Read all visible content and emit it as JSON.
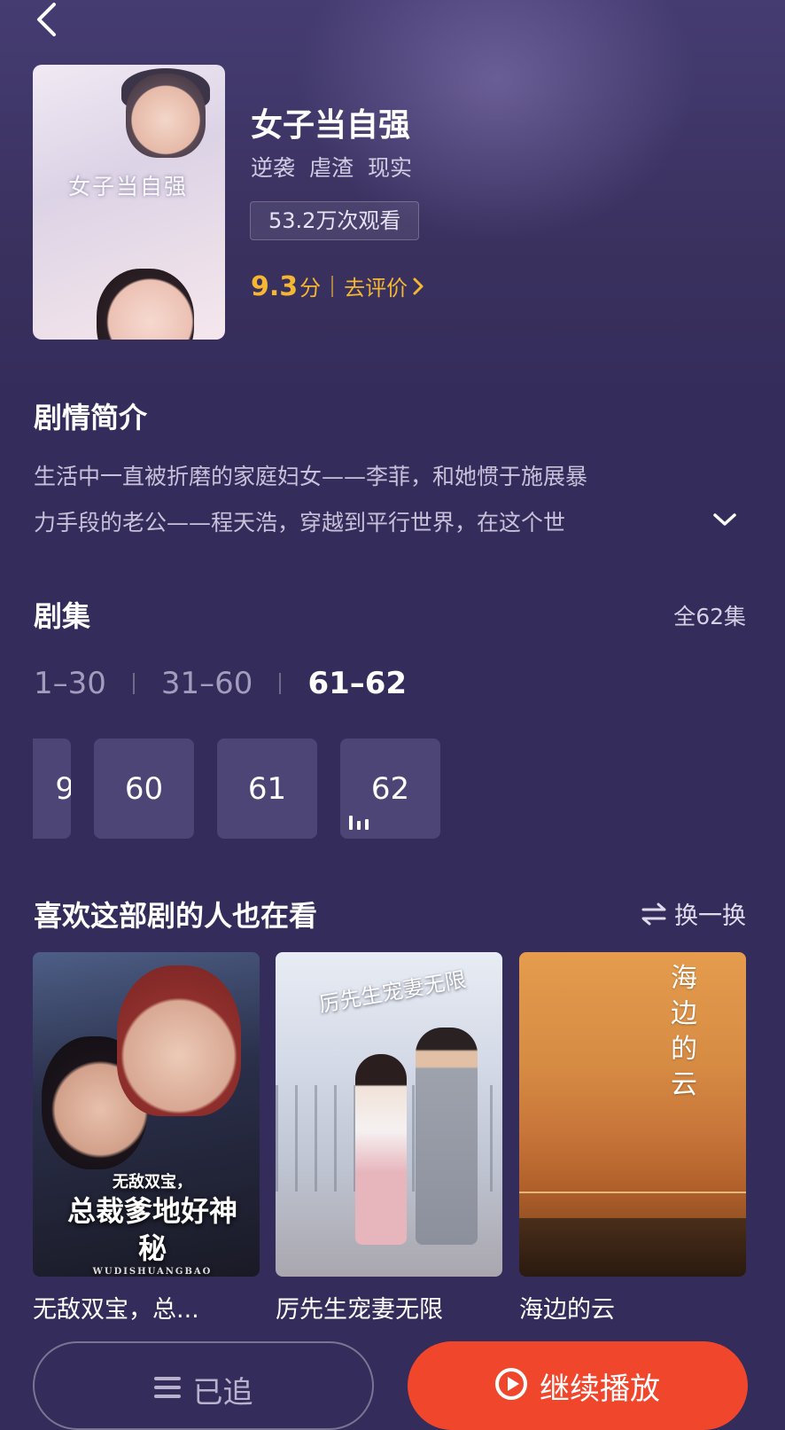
{
  "drama": {
    "title": "女子当自强",
    "poster_text": "女子当自强",
    "tags": [
      "逆袭",
      "虐渣",
      "现实"
    ],
    "views": "53.2万次观看",
    "score": "9.3",
    "score_unit": "分",
    "rate_label": "去评价"
  },
  "synopsis": {
    "heading": "剧情简介",
    "line1": "生活中一直被折磨的家庭妇女——李菲，和她惯于施展暴",
    "line2": "力手段的老公——程天浩，穿越到平行世界，在这个世"
  },
  "episodes": {
    "heading": "剧集",
    "total": "全62集",
    "ranges": [
      "1–30",
      "31–60",
      "61–62"
    ],
    "active_range": "61–62",
    "visible": [
      "9",
      "60",
      "61",
      "62"
    ],
    "playing": "62"
  },
  "recommend": {
    "heading": "喜欢这部剧的人也在看",
    "refresh_label": "换一换",
    "items": [
      {
        "name": "无敌双宝，总...",
        "cover_small": "无敌双宝，",
        "cover_main": "总裁爹地好神秘",
        "cover_en": "WUDISHUANGBAO"
      },
      {
        "name": "厉先生宠妻无限",
        "cover_main": "厉先生宠妻无限"
      },
      {
        "name": "海边的云",
        "cover_main": "海边的云"
      }
    ]
  },
  "actions": {
    "follow_label": "已追",
    "play_label": "继续播放"
  },
  "colors": {
    "background": "#342c5a",
    "accent_gold": "#f5b631",
    "play_button": "#f0462c"
  }
}
